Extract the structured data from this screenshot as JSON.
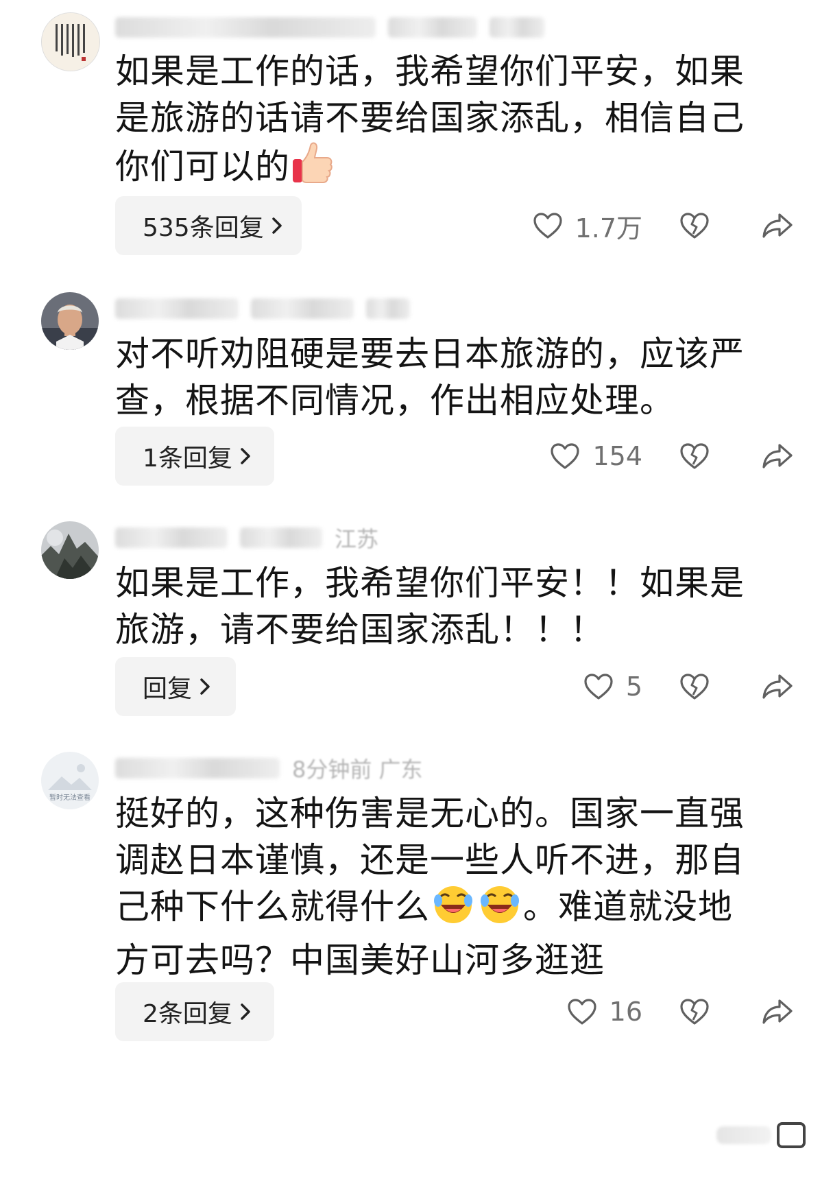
{
  "comments": [
    {
      "meta_text": "",
      "text_before_emoji": "如果是工作的话，我希望你们平安，如果是旅游的话请不要给国家添乱，相信自己你们可以的",
      "emoji": "thumbs-up-emoji",
      "reply_label": "535条回复",
      "like_count": "1.7万"
    },
    {
      "meta_text": "",
      "text": "对不听劝阻硬是要去日本旅游的，应该严查，根据不同情况，作出相应处理。",
      "reply_label": "1条回复",
      "like_count": "154"
    },
    {
      "meta_text": "江苏",
      "text": "如果是工作，我希望你们平安！！如果是旅游，请不要给国家添乱！！！",
      "reply_label": "回复",
      "like_count": "5"
    },
    {
      "meta_text": "8分钟前  广东",
      "avatar_text": "暂时无法查看",
      "text_part1": "挺好的，这种伤害是无心的。国家一直强调赵日本谨慎，还是一些人听不进，那自己种下什么就得什么",
      "emoji": "rolling-laughing-emoji",
      "text_part2": "。难道就没地方可去吗？中国美好山河多逛逛",
      "reply_label": "2条回复",
      "like_count": "16"
    }
  ],
  "icons": {
    "like": "heart-outline-icon",
    "dislike": "broken-heart-icon",
    "share": "share-arrow-icon",
    "chevron": "chevron-right-icon"
  },
  "colors": {
    "text": "#141414",
    "muted": "#707070",
    "reply_bg": "#f3f3f3"
  }
}
